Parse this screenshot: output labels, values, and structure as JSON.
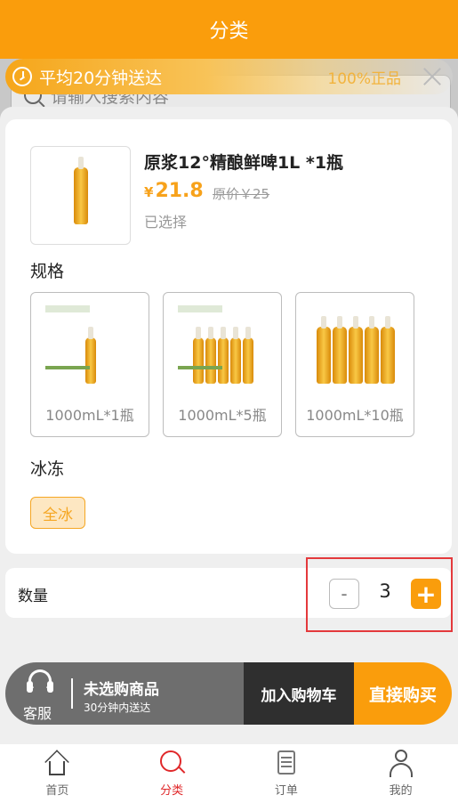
{
  "header": {
    "title": "分类"
  },
  "search": {
    "placeholder": "请输入搜索内容"
  },
  "promo": {
    "delivery_text": "平均20分钟送达",
    "genuine_text": "100%正品"
  },
  "product": {
    "title": "原浆12°精酿鲜啤1L *1瓶",
    "currency": "¥",
    "price": "21.8",
    "original_price": "原价￥25",
    "status": "已选择"
  },
  "spec": {
    "label": "规格",
    "options": [
      {
        "label": "1000mL*1瓶"
      },
      {
        "label": "1000mL*5瓶"
      },
      {
        "label": "1000mL*10瓶"
      }
    ]
  },
  "freeze": {
    "label": "冰冻",
    "option": "全冰"
  },
  "quantity": {
    "label": "数量",
    "minus": "-",
    "value": "3",
    "plus": "+"
  },
  "cart_bar": {
    "service_label": "客服",
    "title": "未选购商品",
    "subtitle": "30分钟内送达",
    "add_to_cart": "加入购物车",
    "buy_now": "直接购买"
  },
  "tabs": [
    {
      "label": "首页",
      "icon": "home-icon"
    },
    {
      "label": "分类",
      "icon": "category-icon",
      "active": true
    },
    {
      "label": "订单",
      "icon": "order-icon"
    },
    {
      "label": "我的",
      "icon": "profile-icon"
    }
  ],
  "colors": {
    "accent": "#fa9d0c",
    "active_tab": "#e0282a",
    "highlight": "#e4393c"
  }
}
